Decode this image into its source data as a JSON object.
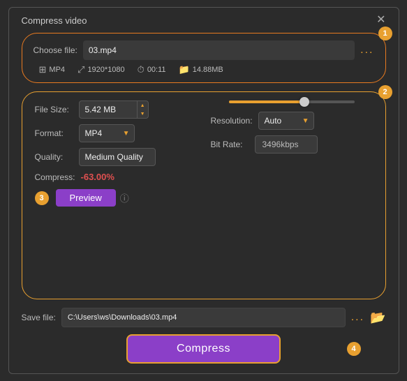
{
  "dialog": {
    "title": "Compress video",
    "close_label": "✕"
  },
  "choose_file": {
    "label": "Choose file:",
    "filename": "03.mp4",
    "dots": "...",
    "meta": {
      "format": "MP4",
      "resolution": "1920*1080",
      "duration": "00:11",
      "size": "14.88MB"
    }
  },
  "settings": {
    "file_size_label": "File Size:",
    "file_size_value": "5.42 MB",
    "format_label": "Format:",
    "format_value": "MP4",
    "quality_label": "Quality:",
    "quality_value": "Medium Quality",
    "compress_label": "Compress:",
    "compress_value": "-63.00%",
    "preview_label": "Preview",
    "resolution_label": "Resolution:",
    "resolution_value": "Auto",
    "bitrate_label": "Bit Rate:",
    "bitrate_value": "3496kbps",
    "slider_pct": 60
  },
  "save_file": {
    "label": "Save file:",
    "path": "C:\\Users\\ws\\Downloads\\03.mp4",
    "dots": "..."
  },
  "compress_button": {
    "label": "Compress"
  },
  "badges": {
    "step1": "1",
    "step2": "2",
    "step3": "3",
    "step4": "4"
  }
}
